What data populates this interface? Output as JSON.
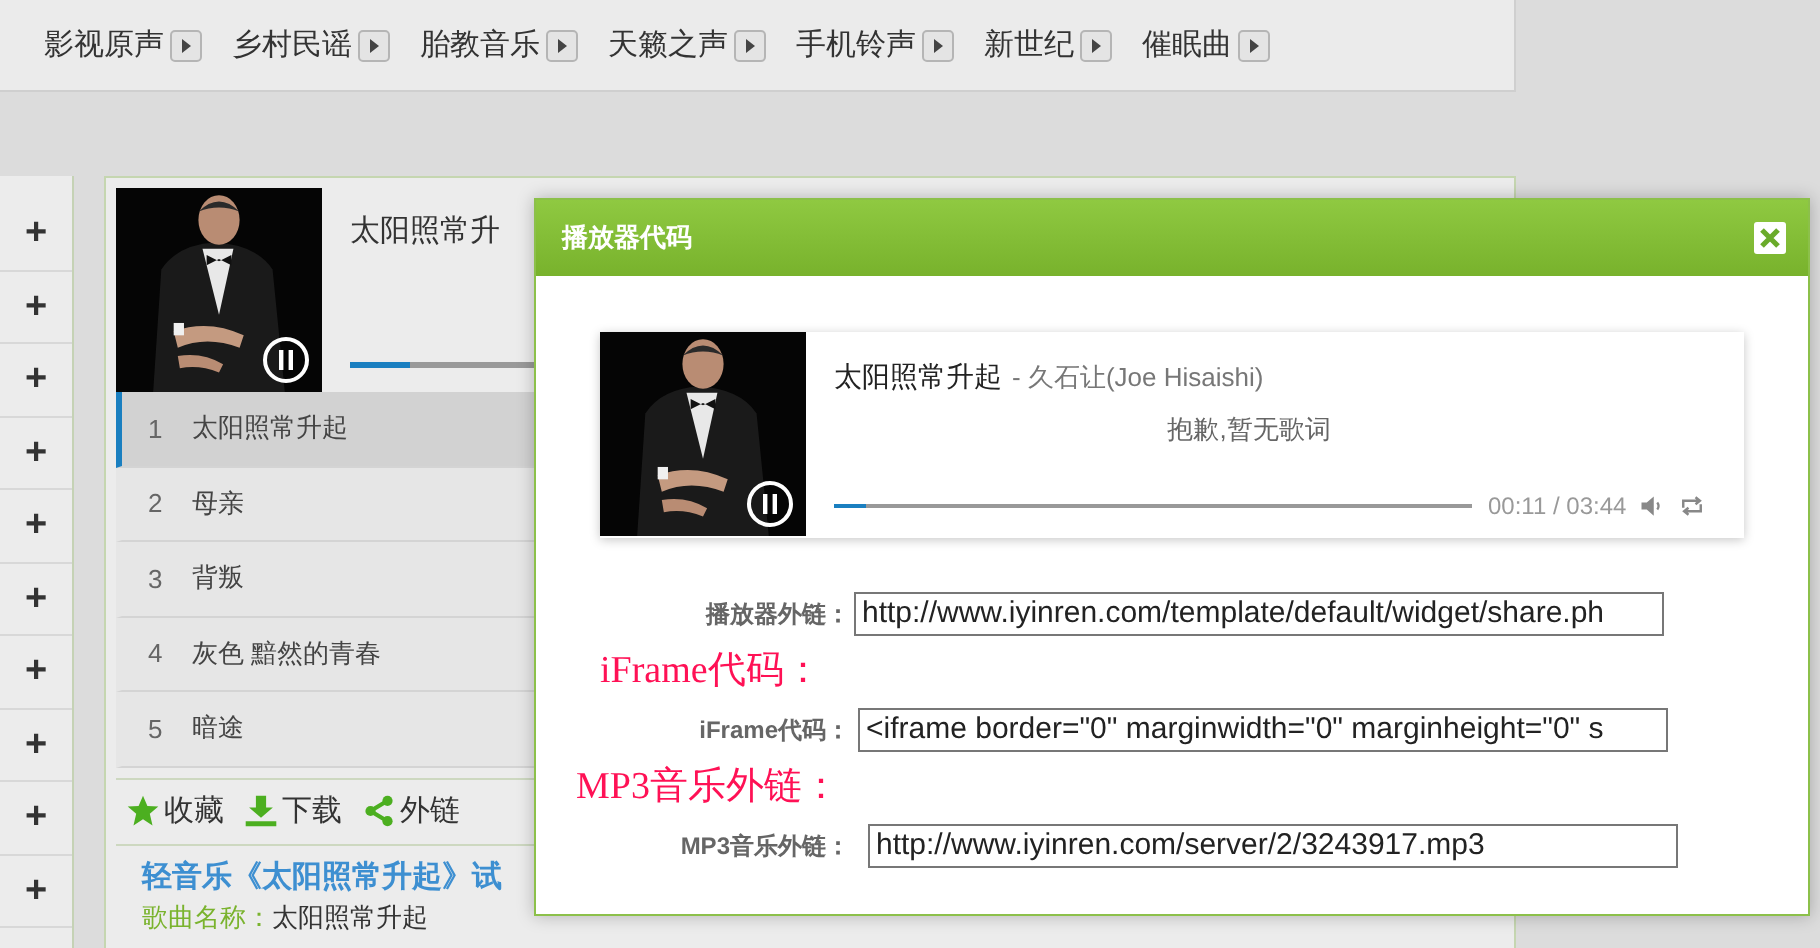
{
  "nav": [
    {
      "label": "影视原声"
    },
    {
      "label": "乡村民谣"
    },
    {
      "label": "胎教音乐"
    },
    {
      "label": "天籁之声"
    },
    {
      "label": "手机铃声"
    },
    {
      "label": "新世纪"
    },
    {
      "label": "催眠曲"
    }
  ],
  "sidebar": {
    "buttons": [
      "+",
      "+",
      "+",
      "+",
      "+",
      "+",
      "+",
      "+",
      "+",
      "+"
    ]
  },
  "player": {
    "title": "太阳照常升",
    "level": 0.1,
    "playlist": [
      {
        "number": "1",
        "title": "太阳照常升起",
        "selected": true
      },
      {
        "number": "2",
        "title": "母亲",
        "selected": false
      },
      {
        "number": "3",
        "title": "背叛",
        "selected": false
      },
      {
        "number": "4",
        "title": "灰色 黯然的青春",
        "selected": false
      },
      {
        "number": "5",
        "title": "暗途",
        "selected": false
      }
    ]
  },
  "toolbar": [
    {
      "kind": "star",
      "label": "收藏"
    },
    {
      "kind": "download",
      "label": "下载"
    },
    {
      "kind": "share",
      "label": "外链"
    }
  ],
  "article": {
    "heading": "轻音乐《太阳照常升起》试",
    "song_label": "歌曲名称：",
    "song_name": "太阳照常升起"
  },
  "dialog": {
    "title": "播放器代码",
    "player": {
      "title": "太阳照常升起",
      "artist": "- 久石让(Joe Hisaishi)",
      "lyric": "抱歉,暂无歌词",
      "level": 0.05,
      "time": "00:11 / 03:44"
    },
    "rows": [
      {
        "kind": "field",
        "label": "播放器外链：",
        "value": "http://www.iyinren.com/template/default/widget/share.ph"
      },
      {
        "kind": "note",
        "text": "iFrame代码："
      },
      {
        "kind": "field",
        "label": "iFrame代码：",
        "value": "<iframe border=\"0\" marginwidth=\"0\" marginheight=\"0\" s"
      },
      {
        "kind": "note",
        "text": "MP3音乐外链："
      },
      {
        "kind": "field",
        "label": "MP3音乐外链：",
        "value": "http://www.iyinren.com/server/2/3243917.mp3"
      }
    ]
  }
}
